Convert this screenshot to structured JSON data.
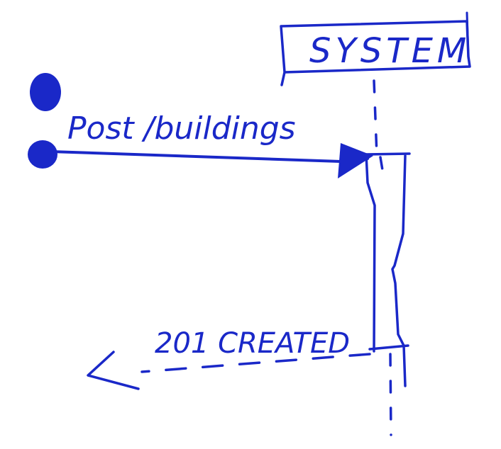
{
  "diagram": {
    "type": "sequence-diagram",
    "participant": {
      "label": "SYSTEM"
    },
    "messages": [
      {
        "label": "Post /buildings",
        "direction": "request",
        "style": "solid"
      },
      {
        "label": "201 CREATED",
        "direction": "response",
        "style": "dashed"
      }
    ]
  },
  "colors": {
    "ink": "#1a28c8",
    "background": "#ffffff"
  }
}
